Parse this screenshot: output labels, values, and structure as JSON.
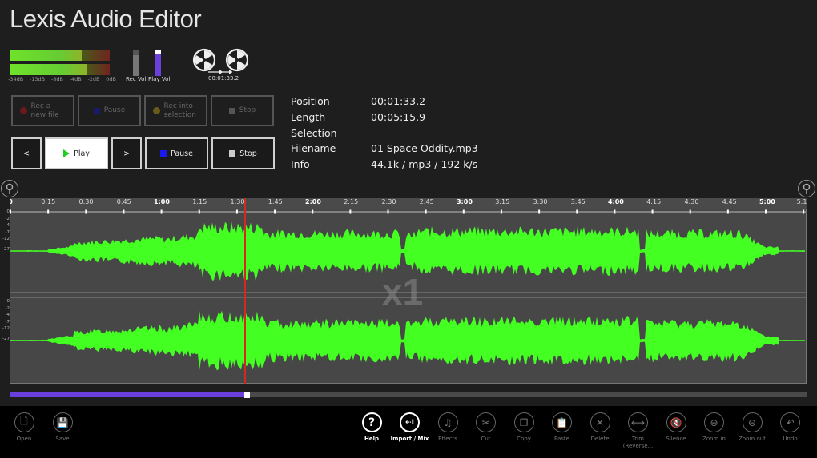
{
  "app": {
    "title": "Lexis Audio Editor"
  },
  "meters": {
    "levels": [
      0.72,
      0.77
    ],
    "db_scale": [
      "-34dB",
      "-13dB",
      "-8dB",
      "-4dB",
      "-2dB",
      "0dB"
    ],
    "rec_vol_label": "Rec Vol",
    "play_vol_label": "Play Vol",
    "rec_vol": 0.8,
    "play_vol": 0.82,
    "reel_time": "00:01:33.2"
  },
  "record_buttons": [
    {
      "label": "Rec a new file",
      "icon": "record-dot-icon",
      "color": "#7a1a1a"
    },
    {
      "label": "Pause",
      "icon": "pause-icon",
      "color": "#1a1a7a"
    },
    {
      "label": "Rec into selection",
      "icon": "record-dot-icon",
      "color": "#7a6a1a"
    },
    {
      "label": "Stop",
      "icon": "stop-icon",
      "color": "#555555"
    }
  ],
  "play_buttons": [
    {
      "label": "<",
      "icon": ""
    },
    {
      "label": "Play",
      "icon": "play-icon",
      "color": "#22cc22"
    },
    {
      "label": ">",
      "icon": ""
    },
    {
      "label": "Pause",
      "icon": "pause-icon",
      "color": "#1a1aee"
    },
    {
      "label": "Stop",
      "icon": "stop-icon",
      "color": "#cccccc"
    }
  ],
  "info": [
    {
      "label": "Position",
      "value": "00:01:33.2"
    },
    {
      "label": "Length",
      "value": "00:05:15.9"
    },
    {
      "label": "Selection",
      "value": ""
    },
    {
      "label": "Filename",
      "value": "01 Space Oddity.mp3"
    },
    {
      "label": "Info",
      "value": "44.1k / mp3 / 192 k/s"
    }
  ],
  "timeline": {
    "total_seconds": 315.9,
    "position_seconds": 93.2,
    "ticks": [
      {
        "t": 0,
        "label": "0",
        "major": true
      },
      {
        "t": 15,
        "label": "0:15"
      },
      {
        "t": 30,
        "label": "0:30"
      },
      {
        "t": 45,
        "label": "0:45"
      },
      {
        "t": 60,
        "label": "1:00",
        "major": true
      },
      {
        "t": 75,
        "label": "1:15"
      },
      {
        "t": 90,
        "label": "1:30"
      },
      {
        "t": 105,
        "label": "1:45"
      },
      {
        "t": 120,
        "label": "2:00",
        "major": true
      },
      {
        "t": 135,
        "label": "2:15"
      },
      {
        "t": 150,
        "label": "2:30"
      },
      {
        "t": 165,
        "label": "2:45"
      },
      {
        "t": 180,
        "label": "3:00",
        "major": true
      },
      {
        "t": 195,
        "label": "3:15"
      },
      {
        "t": 210,
        "label": "3:30"
      },
      {
        "t": 225,
        "label": "3:45"
      },
      {
        "t": 240,
        "label": "4:00",
        "major": true
      },
      {
        "t": 255,
        "label": "4:15"
      },
      {
        "t": 270,
        "label": "4:30"
      },
      {
        "t": 285,
        "label": "4:45"
      },
      {
        "t": 300,
        "label": "5:00",
        "major": true
      },
      {
        "t": 315,
        "label": "5:1"
      }
    ],
    "db_ticks": [
      "0",
      "-2",
      "-4",
      "-7",
      "-12",
      "-27"
    ],
    "zoom_label": "x1",
    "wave_color": "#44ff22",
    "playhead_color": "#d42a1e"
  },
  "progress": {
    "fraction": 0.295,
    "color": "#6a3fdc"
  },
  "appbar": {
    "left": [
      {
        "label": "Open",
        "icon": "open-file-icon",
        "glyph": "🗋",
        "active": false
      },
      {
        "label": "Save",
        "icon": "save-icon",
        "glyph": "💾",
        "active": false
      }
    ],
    "right": [
      {
        "label": "Help",
        "icon": "help-icon",
        "glyph": "?",
        "active": true
      },
      {
        "label": "Import / Mix",
        "icon": "import-icon",
        "glyph": "⇠I",
        "active": true
      },
      {
        "label": "Effects",
        "icon": "effects-icon",
        "glyph": "♫",
        "active": false
      },
      {
        "label": "Cut",
        "icon": "scissors-icon",
        "glyph": "✂",
        "active": false
      },
      {
        "label": "Copy",
        "icon": "copy-icon",
        "glyph": "❐",
        "active": false
      },
      {
        "label": "Paste",
        "icon": "paste-icon",
        "glyph": "📋",
        "active": false
      },
      {
        "label": "Delete",
        "icon": "delete-icon",
        "glyph": "✕",
        "active": false
      },
      {
        "label": "Trim (Reverse...",
        "icon": "trim-icon",
        "glyph": "⟷",
        "active": false
      },
      {
        "label": "Silence",
        "icon": "mute-icon",
        "glyph": "🔇",
        "active": false
      },
      {
        "label": "Zoom in",
        "icon": "zoom-in-icon",
        "glyph": "⊕",
        "active": false
      },
      {
        "label": "Zoom out",
        "icon": "zoom-out-icon",
        "glyph": "⊖",
        "active": false
      },
      {
        "label": "Undo",
        "icon": "undo-icon",
        "glyph": "↶",
        "active": false
      }
    ]
  }
}
